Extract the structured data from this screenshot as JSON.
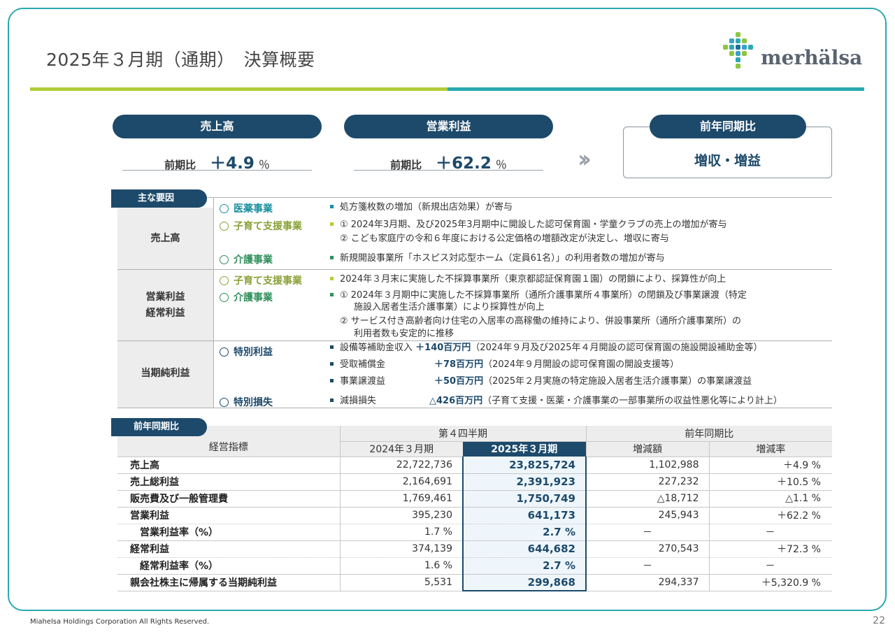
{
  "title": "2025年３月期（通期）　決算概要",
  "logo_text": "merhälsa",
  "kpis": {
    "sales": {
      "header": "売上高",
      "label": "前期比",
      "value": "＋4.9",
      "unit": "％"
    },
    "op": {
      "header": "営業利益",
      "label": "前期比",
      "value": "＋62.2",
      "unit": "％"
    },
    "yoy": {
      "header": "前年同期比",
      "result": "増収・増益"
    }
  },
  "factors": {
    "tag": "主な要因",
    "groups": {
      "sales": "売上高",
      "profit1": "営業利益",
      "profit2": "経常利益",
      "net": "当期純利益"
    },
    "segments": {
      "medical": "医薬事業",
      "child": "子育て支援事業",
      "care": "介護事業",
      "special_gain": "特別利益",
      "special_loss": "特別損失"
    },
    "lines": {
      "s1": "処方箋枚数の増加（新規出店効果）が寄与",
      "s2": "① 2024年3月期、及び2025年3月期中に開設した認可保育園・学童クラブの売上の増加が寄与",
      "s3": "② こども家庭庁の令和６年度における公定価格の増額改定が決定し、増収に寄与",
      "s4": "新規開設事業所「ホスピス対応型ホーム（定員61名）」の利用者数の増加が寄与",
      "p1": "2024年３月末に実施した不採算事業所（東京都認証保育園１園）の閉鎖により、採算性が向上",
      "p2": "① 2024年３月期中に実施した不採算事業所（通所介護事業所４事業所）の閉鎖及び事業譲渡（特定",
      "p3": "施設入居者生活介護事業）により採算性が向上",
      "p4": "② サービス付き高齢者向け住宅の入居率の高稼働の維持により、併設事業所（通所介護事業所）の",
      "p5": "利用者数も安定的に推移",
      "n1_name": "設備等補助金収入",
      "n1_amt": "＋140百万円",
      "n1_note": "（2024年９月及び2025年４月開設の認可保育園の施設開設補助金等）",
      "n2_name": "受取補償金",
      "n2_amt": "＋78百万円",
      "n2_note": "（2024年９月開設の認可保育園の開設支援等）",
      "n3_name": "事業譲渡益",
      "n3_amt": "＋50百万円",
      "n3_note": "（2025年２月実施の特定施設入居者生活介護事業）の事業譲渡益",
      "n4_name": "減損損失",
      "n4_amt": "△426百万円",
      "n4_note": "（子育て支援・医薬・介護事業の一部事業所の収益性悪化等により計上）"
    }
  },
  "table": {
    "tag": "前年同期比",
    "h_indicator": "経営指標",
    "h_q4": "第４四半期",
    "h_yoy": "前年同期比",
    "h_prev": "2024年３月期",
    "h_cur": "2025年３月期",
    "h_diff": "増減額",
    "h_rate": "増減率",
    "rows": [
      {
        "name": "売上高",
        "prev": "22,722,736",
        "cur": "23,825,724",
        "diff": "1,102,988",
        "rate": "＋4.9 %"
      },
      {
        "name": "売上総利益",
        "prev": "2,164,691",
        "cur": "2,391,923",
        "diff": "227,232",
        "rate": "＋10.5 %"
      },
      {
        "name": "販売費及び一般管理費",
        "prev": "1,769,461",
        "cur": "1,750,749",
        "diff": "△18,712",
        "rate": "△1.1 %"
      },
      {
        "name": "営業利益",
        "prev": "395,230",
        "cur": "641,173",
        "diff": "245,943",
        "rate": "＋62.2 %"
      },
      {
        "name": "営業利益率（%）",
        "prev": "1.7 %",
        "cur": "2.7 %",
        "diff": "－",
        "rate": "－"
      },
      {
        "name": "経常利益",
        "prev": "374,139",
        "cur": "644,682",
        "diff": "270,543",
        "rate": "＋72.3 %"
      },
      {
        "name": "経常利益率（%）",
        "prev": "1.6 %",
        "cur": "2.7 %",
        "diff": "－",
        "rate": "－"
      },
      {
        "name": "親会社株主に帰属する当期純利益",
        "prev": "5,531",
        "cur": "299,868",
        "diff": "294,337",
        "rate": "＋5,320.9 %"
      }
    ]
  },
  "footer": "Miahelsa Holdings Corporation All Rights Reserved.",
  "page_number": "22"
}
